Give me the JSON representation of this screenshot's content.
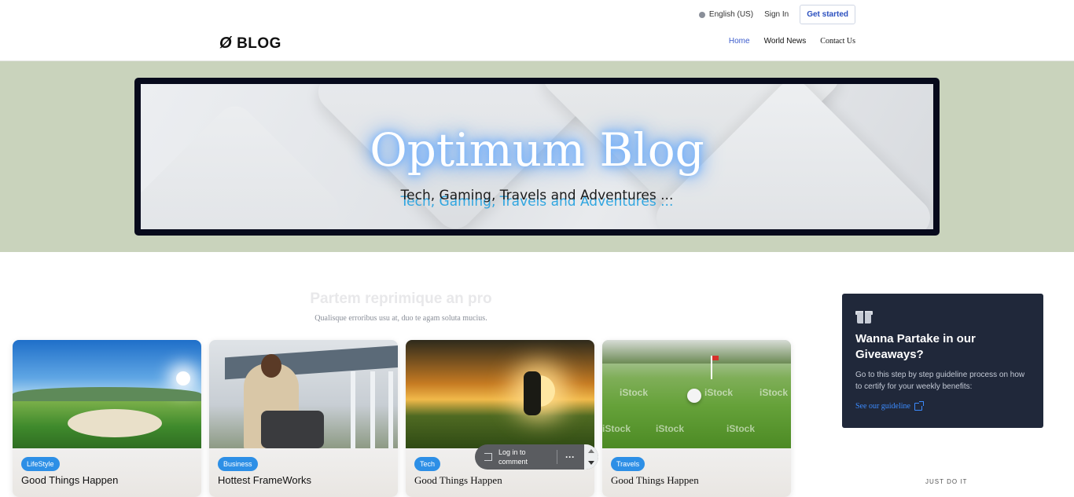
{
  "header": {
    "language": "English (US)",
    "sign_in": "Sign In",
    "get_started": "Get started",
    "brand_mark": "Ø",
    "brand": "BLOG",
    "nav": [
      "Home",
      "World News",
      "Contact Us"
    ]
  },
  "hero": {
    "title": "Optimum Blog",
    "subtitle": "Tech, Gaming, Travels and Adventures ..."
  },
  "section": {
    "title": "Partem reprimique an pro",
    "subtitle": "Qualisque erroribus usu at, duo te agam soluta mucius."
  },
  "cards": [
    {
      "tag": "LifeStyle",
      "title": "Good Things Happen"
    },
    {
      "tag": "Business",
      "title": "Hottest FrameWorks"
    },
    {
      "tag": "Tech",
      "title": "Good Things Happen"
    },
    {
      "tag": "Travels",
      "title": "Good Things Happen"
    }
  ],
  "watermarks": [
    "iStock",
    "iStock",
    "iStock",
    "iStock",
    "iStock",
    "iStock"
  ],
  "giveaway": {
    "title": "Wanna Partake in our Giveaways?",
    "text": "Go to this step by step guideline process on how to certify for your weekly benefits:",
    "link": "See our guideline"
  },
  "sidebar_label": "JUST DO IT",
  "comment_pill": {
    "label": "Log in to comment",
    "more": "···"
  },
  "colors": {
    "accent": "#3b5bcc",
    "badge": "#2d8fe6",
    "hero_bg": "#c9d3bc",
    "sidebar_card": "#20283a"
  }
}
